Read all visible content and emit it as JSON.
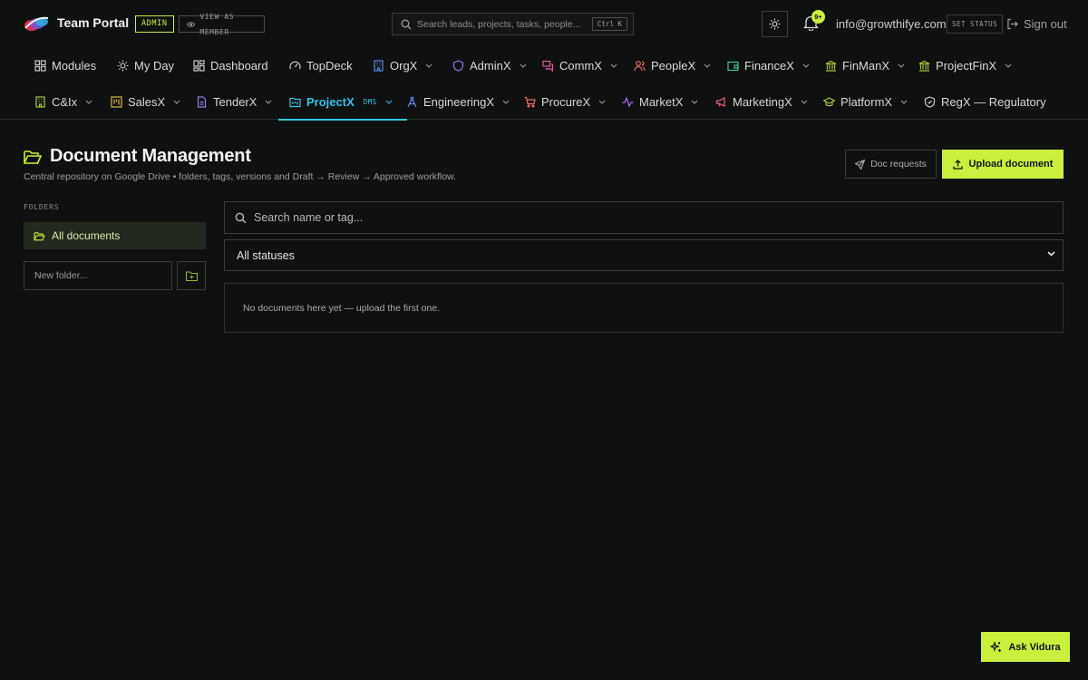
{
  "header": {
    "app_title": "Team Portal",
    "role_badge": "ADMIN",
    "view_as_member": "VIEW AS MEMBER",
    "search_placeholder": "Search leads, projects, tasks, people...",
    "search_shortcut": "Ctrl K",
    "notification_count": "9+",
    "user_email": "info@growthifye.com",
    "set_status": "SET STATUS",
    "sign_out": "Sign out"
  },
  "nav": {
    "row1": [
      {
        "label": "Modules",
        "icon": "grid-icon",
        "dropdown": false
      },
      {
        "label": "My Day",
        "icon": "sun-icon",
        "dropdown": false
      },
      {
        "label": "Dashboard",
        "icon": "dashboard-icon",
        "dropdown": false
      },
      {
        "label": "TopDeck",
        "icon": "gauge-icon",
        "dropdown": false
      },
      {
        "label": "OrgX",
        "icon": "building-icon",
        "dropdown": true
      },
      {
        "label": "AdminX",
        "icon": "shield-icon",
        "dropdown": true
      },
      {
        "label": "CommX",
        "icon": "chat-icon",
        "dropdown": true
      },
      {
        "label": "PeopleX",
        "icon": "people-icon",
        "dropdown": true
      },
      {
        "label": "FinanceX",
        "icon": "wallet-icon",
        "dropdown": true
      },
      {
        "label": "FinManX",
        "icon": "bank-icon",
        "dropdown": true
      },
      {
        "label": "ProjectFinX",
        "icon": "bank-icon",
        "dropdown": true
      }
    ],
    "row2": [
      {
        "label": "C&Ix",
        "icon": "building-icon",
        "dropdown": true
      },
      {
        "label": "SalesX",
        "icon": "kanban-icon",
        "dropdown": true
      },
      {
        "label": "TenderX",
        "icon": "file-icon",
        "dropdown": true
      },
      {
        "label": "ProjectX",
        "icon": "folder-kanban-icon",
        "dropdown": true,
        "active": true,
        "tag": "DMS"
      },
      {
        "label": "EngineeringX",
        "icon": "compass-icon",
        "dropdown": true
      },
      {
        "label": "ProcureX",
        "icon": "cart-icon",
        "dropdown": true
      },
      {
        "label": "MarketX",
        "icon": "pulse-icon",
        "dropdown": true
      },
      {
        "label": "MarketingX",
        "icon": "megaphone-icon",
        "dropdown": true
      },
      {
        "label": "PlatformX",
        "icon": "graduation-icon",
        "dropdown": true
      },
      {
        "label": "RegX — Regulatory",
        "icon": "shield-check-icon",
        "dropdown": false
      }
    ]
  },
  "page": {
    "title": "Document Management",
    "subtitle": "Central repository on Google Drive • folders, tags, versions and Draft → Review → Approved workflow.",
    "doc_requests": "Doc requests",
    "upload": "Upload document"
  },
  "sidebar": {
    "folders_label": "FOLDERS",
    "all_documents": "All documents",
    "new_folder_placeholder": "New folder..."
  },
  "main": {
    "search_placeholder": "Search name or tag...",
    "status_value": "All statuses",
    "empty_text": "No documents here yet — upload the first one."
  },
  "assistant": {
    "label": "Ask Vidura"
  },
  "colors": {
    "accent": "#c8f03c",
    "active_tab": "#35c3e8",
    "background": "#0f1110",
    "border": "#3a3d39"
  }
}
